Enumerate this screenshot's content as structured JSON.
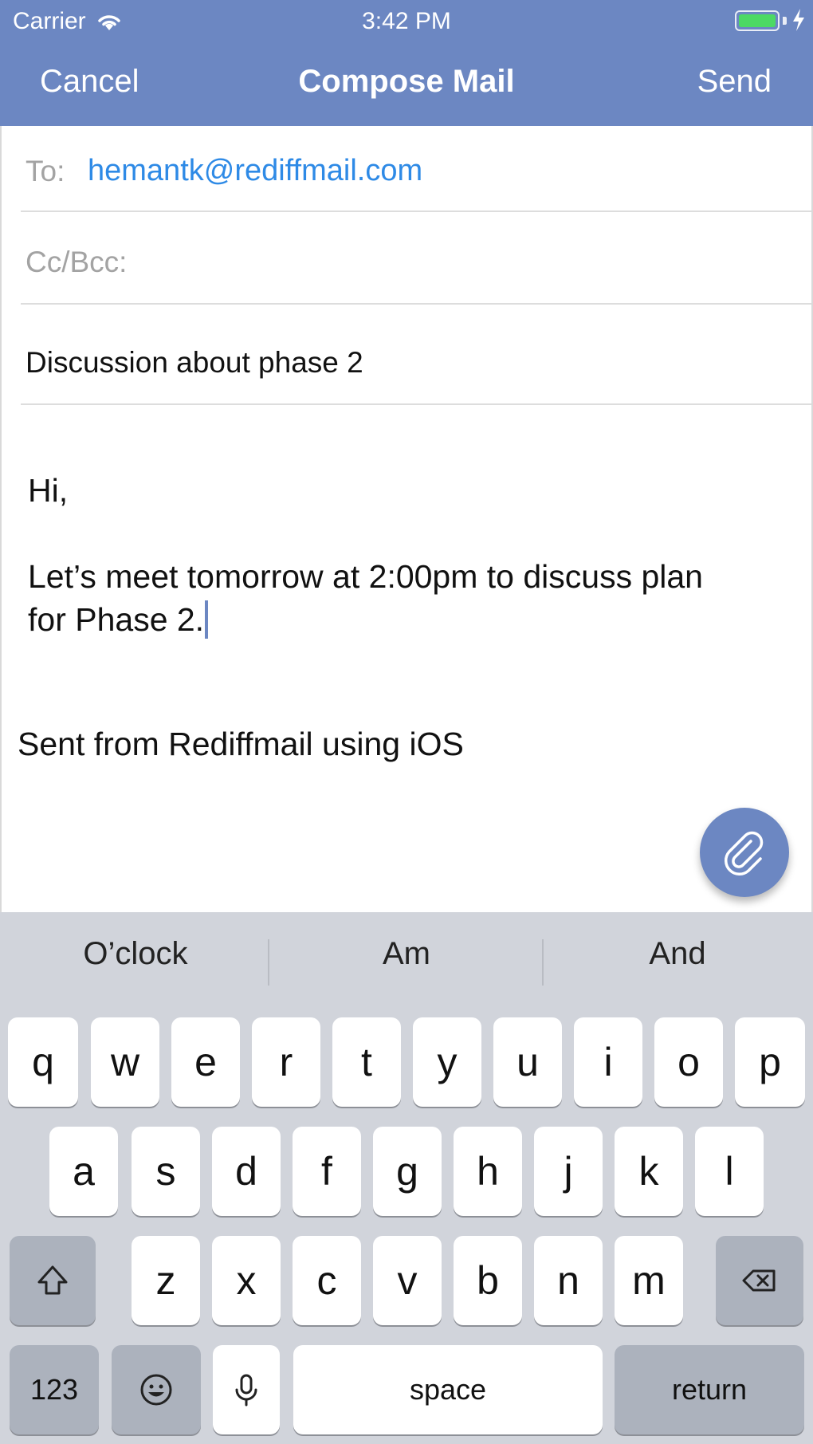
{
  "status_bar": {
    "carrier": "Carrier",
    "time": "3:42 PM"
  },
  "nav": {
    "cancel_label": "Cancel",
    "title": "Compose Mail",
    "send_label": "Send"
  },
  "compose": {
    "to_label": "To:",
    "to_value": "hemantk@rediffmail.com",
    "cc_label": "Cc/Bcc:",
    "subject_value": "Discussion about phase 2",
    "body": {
      "line1": "Hi,",
      "line2": "Let’s meet tomorrow at 2:00pm to discuss plan",
      "line3": "for Phase 2."
    },
    "signature": "Sent from Rediffmail using iOS",
    "attach_icon": "paperclip-icon"
  },
  "keyboard": {
    "suggestions": [
      "O’clock",
      "Am",
      "And"
    ],
    "row1": [
      "q",
      "w",
      "e",
      "r",
      "t",
      "y",
      "u",
      "i",
      "o",
      "p"
    ],
    "row2": [
      "a",
      "s",
      "d",
      "f",
      "g",
      "h",
      "j",
      "k",
      "l"
    ],
    "row3": [
      "z",
      "x",
      "c",
      "v",
      "b",
      "n",
      "m"
    ],
    "numbers_label": "123",
    "space_label": "space",
    "return_label": "return",
    "shift_icon": "shift-icon",
    "delete_icon": "backspace-icon",
    "emoji_icon": "emoji-icon",
    "mic_icon": "microphone-icon"
  },
  "colors": {
    "brand": "#6c87c2",
    "link": "#2e8ae6",
    "keyboard_bg": "#d1d4db",
    "battery": "#4cd964"
  }
}
